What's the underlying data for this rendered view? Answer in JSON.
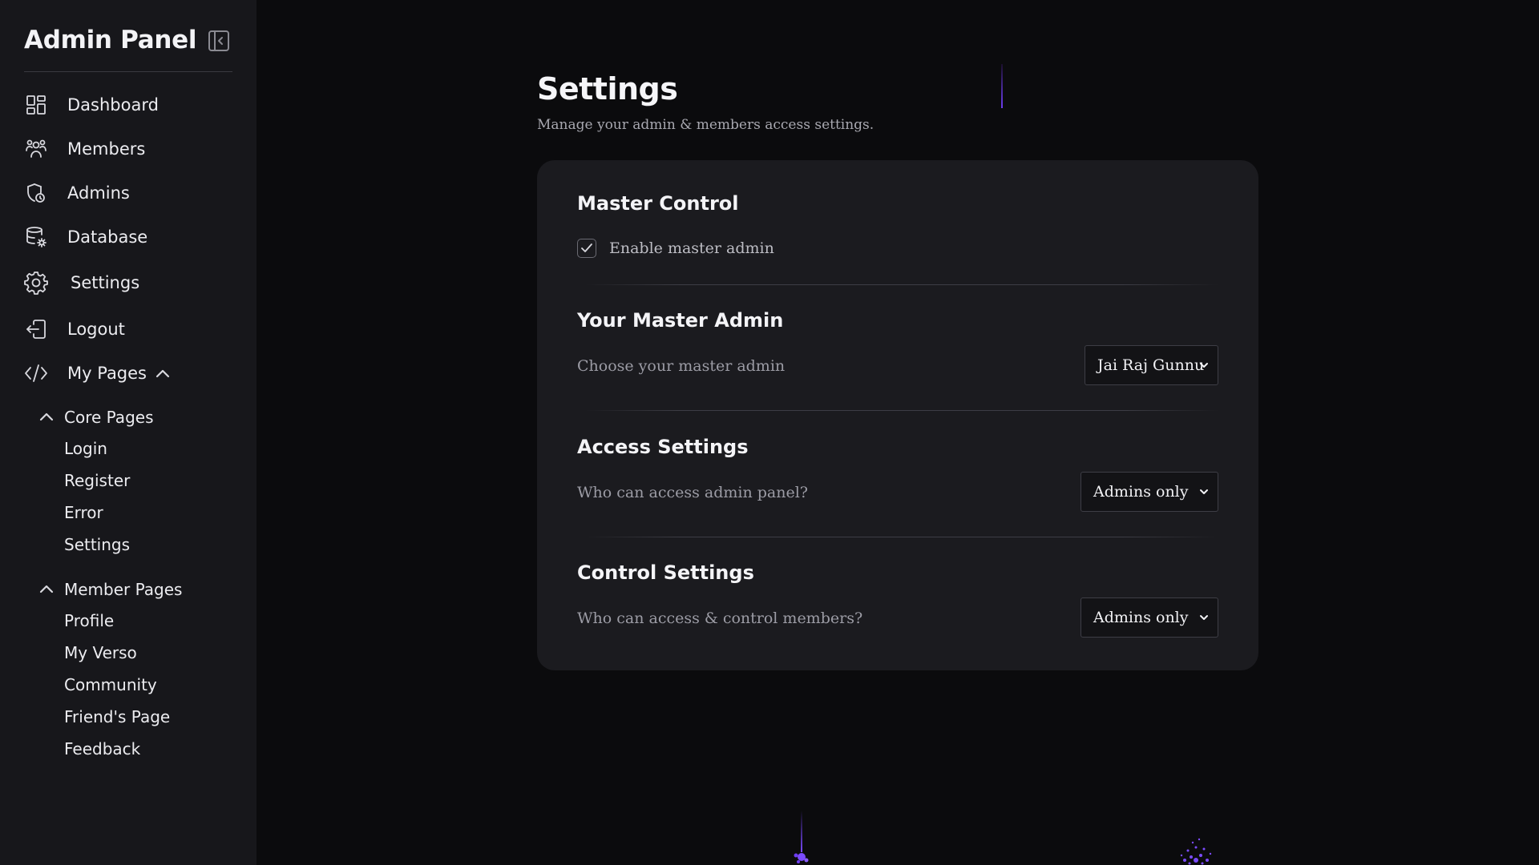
{
  "sidebar": {
    "brand_title": "Admin Panel",
    "collapse_icon": "sidebar-collapse-icon",
    "nav": [
      {
        "label": "Dashboard",
        "icon": "dashboard-grid-icon"
      },
      {
        "label": "Members",
        "icon": "users-icon"
      },
      {
        "label": "Admins",
        "icon": "admin-shield-icon"
      },
      {
        "label": "Database",
        "icon": "database-settings-icon"
      },
      {
        "label": "Settings",
        "icon": "gear-icon"
      },
      {
        "label": "Logout",
        "icon": "logout-icon"
      },
      {
        "label": "My Pages",
        "icon": "code-icon",
        "expanded": true
      }
    ],
    "groups": [
      {
        "label": "Core Pages",
        "expanded": true,
        "items": [
          "Login",
          "Register",
          "Error",
          "Settings"
        ]
      },
      {
        "label": "Member Pages",
        "expanded": true,
        "items": [
          "Profile",
          "My Verso",
          "Community",
          "Friend's Page",
          "Feedback"
        ]
      }
    ]
  },
  "main": {
    "title": "Settings",
    "subtitle": "Manage your admin & members access settings."
  },
  "settings": {
    "master_control": {
      "title": "Master Control",
      "checkbox_label": "Enable master admin",
      "checked": true
    },
    "master_admin": {
      "title": "Your Master Admin",
      "description": "Choose your master admin",
      "selected": "Jai Raj Gunnu"
    },
    "access": {
      "title": "Access Settings",
      "description": "Who can access admin panel?",
      "selected": "Admins only"
    },
    "control": {
      "title": "Control Settings",
      "description": "Who can access & control members?",
      "selected": "Admins only"
    }
  },
  "colors": {
    "background": "#0b0b0d",
    "sidebar": "#17171b",
    "card": "#1b1b1f",
    "accent": "#6d3df0"
  }
}
